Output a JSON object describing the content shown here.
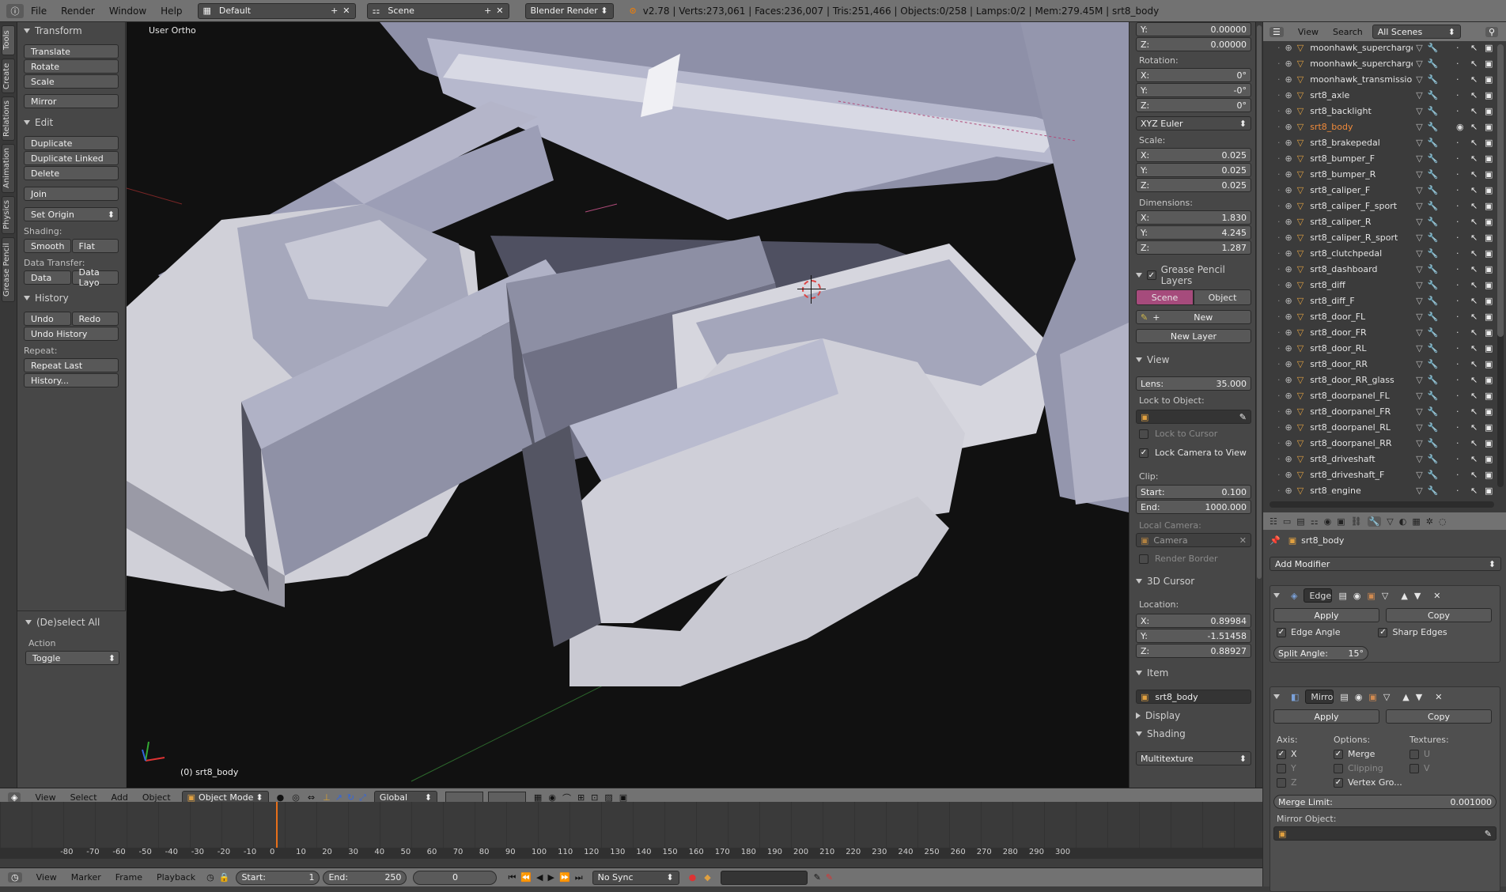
{
  "topbar": {
    "menus": [
      "File",
      "Render",
      "Window",
      "Help"
    ],
    "layout": "Default",
    "scene": "Scene",
    "engine": "Blender Render",
    "stats": "v2.78 | Verts:273,061 | Faces:236,007 | Tris:251,466 | Objects:0/258 | Lamps:0/2 | Mem:279.45M | srt8_body"
  },
  "left_tabs": [
    "Tools",
    "Create",
    "Relations",
    "Animation",
    "Physics",
    "Grease Pencil"
  ],
  "tool": {
    "transform": {
      "title": "Transform",
      "buttons": [
        "Translate",
        "Rotate",
        "Scale",
        "Mirror"
      ]
    },
    "edit": {
      "title": "Edit",
      "buttons": [
        "Duplicate",
        "Duplicate Linked",
        "Delete",
        "Join",
        "Set Origin"
      ],
      "shading_label": "Shading:",
      "smooth": "Smooth",
      "flat": "Flat",
      "transfer_label": "Data Transfer:",
      "data": "Data",
      "data_layo": "Data Layo"
    },
    "history": {
      "title": "History",
      "undo": "Undo",
      "redo": "Redo",
      "undo_history": "Undo History",
      "repeat_label": "Repeat:",
      "repeat_last": "Repeat Last",
      "history": "History..."
    },
    "operator": {
      "title": "(De)select All",
      "action_label": "Action",
      "action_value": "Toggle"
    }
  },
  "viewport": {
    "mode_label": "User Ortho",
    "object_label": "(0) srt8_body"
  },
  "npanel": {
    "loc_y": "0.00000",
    "loc_z": "0.00000",
    "rotation_label": "Rotation:",
    "rot_x": "0°",
    "rot_y": "-0°",
    "rot_z": "0°",
    "rot_mode": "XYZ Euler",
    "scale_label": "Scale:",
    "scale_x": "0.025",
    "scale_y": "0.025",
    "scale_z": "0.025",
    "dim_label": "Dimensions:",
    "dim_x": "1.830",
    "dim_y": "4.245",
    "dim_z": "1.287",
    "gp_title": "Grease Pencil Layers",
    "gp_scene": "Scene",
    "gp_object": "Object",
    "gp_new": "New",
    "gp_new_layer": "New Layer",
    "view_title": "View",
    "lens_label": "Lens:",
    "lens": "35.000",
    "lock_obj_label": "Lock to Object:",
    "lock_cursor": "Lock to Cursor",
    "lock_cam": "Lock Camera to View",
    "clip_label": "Clip:",
    "clip_start_label": "Start:",
    "clip_start": "0.100",
    "clip_end_label": "End:",
    "clip_end": "1000.000",
    "local_cam_label": "Local Camera:",
    "camera": "Camera",
    "render_border": "Render Border",
    "cursor_title": "3D Cursor",
    "cursor_loc_label": "Location:",
    "cur_x": "0.89984",
    "cur_y": "-1.51458",
    "cur_z": "0.88927",
    "item_title": "Item",
    "item_name": "srt8_body",
    "display_title": "Display",
    "shading_title": "Shading",
    "shading_mode": "Multitexture"
  },
  "outliner": {
    "view": "View",
    "search": "Search",
    "filter": "All Scenes",
    "items": [
      "moonhawk_supercharger_stage",
      "moonhawk_supercharger_thrott",
      "moonhawk_transmission",
      "srt8_axle",
      "srt8_backlight",
      "srt8_body",
      "srt8_brakepedal",
      "srt8_bumper_F",
      "srt8_bumper_R",
      "srt8_caliper_F",
      "srt8_caliper_F_sport",
      "srt8_caliper_R",
      "srt8_caliper_R_sport",
      "srt8_clutchpedal",
      "srt8_dashboard",
      "srt8_diff",
      "srt8_diff_F",
      "srt8_door_FL",
      "srt8_door_FR",
      "srt8_door_RL",
      "srt8_door_RR",
      "srt8_door_RR_glass",
      "srt8_doorpanel_FL",
      "srt8_doorpanel_FR",
      "srt8_doorpanel_RL",
      "srt8_doorpanel_RR",
      "srt8_driveshaft",
      "srt8_driveshaft_F",
      "srt8_engine"
    ],
    "selected": "srt8_body"
  },
  "props": {
    "object": "srt8_body",
    "add_modifier": "Add Modifier",
    "mod1": {
      "name": "Edge",
      "apply": "Apply",
      "copy": "Copy",
      "edge_angle": "Edge Angle",
      "sharp_edges": "Sharp Edges",
      "split_label": "Split Angle:",
      "split_value": "15°"
    },
    "mod2": {
      "name": "Mirro",
      "apply": "Apply",
      "copy": "Copy",
      "axis_label": "Axis:",
      "options_label": "Options:",
      "textures_label": "Textures:",
      "x": "X",
      "y": "Y",
      "z": "Z",
      "merge": "Merge",
      "clipping": "Clipping",
      "vertex_gro": "Vertex Gro...",
      "u": "U",
      "v": "V",
      "merge_limit_label": "Merge Limit:",
      "merge_limit": "0.001000",
      "mirror_obj_label": "Mirror Object:"
    }
  },
  "vp_header": {
    "menus": [
      "View",
      "Select",
      "Add",
      "Object"
    ],
    "mode": "Object Mode",
    "orientation": "Global"
  },
  "timeline": {
    "ticks": [
      "-80",
      "-70",
      "-60",
      "-50",
      "-40",
      "-30",
      "-20",
      "-10",
      "0",
      "10",
      "20",
      "30",
      "40",
      "50",
      "60",
      "70",
      "80",
      "90",
      "100",
      "110",
      "120",
      "130",
      "140",
      "150",
      "160",
      "170",
      "180",
      "190",
      "200",
      "210",
      "220",
      "230",
      "240",
      "250",
      "260",
      "270",
      "280",
      "290",
      "300"
    ],
    "current_frame": 0
  },
  "tl_header": {
    "menus": [
      "View",
      "Marker",
      "Frame",
      "Playback"
    ],
    "start_label": "Start:",
    "start": "1",
    "end_label": "End:",
    "end": "250",
    "frame": "0",
    "sync": "No Sync"
  }
}
